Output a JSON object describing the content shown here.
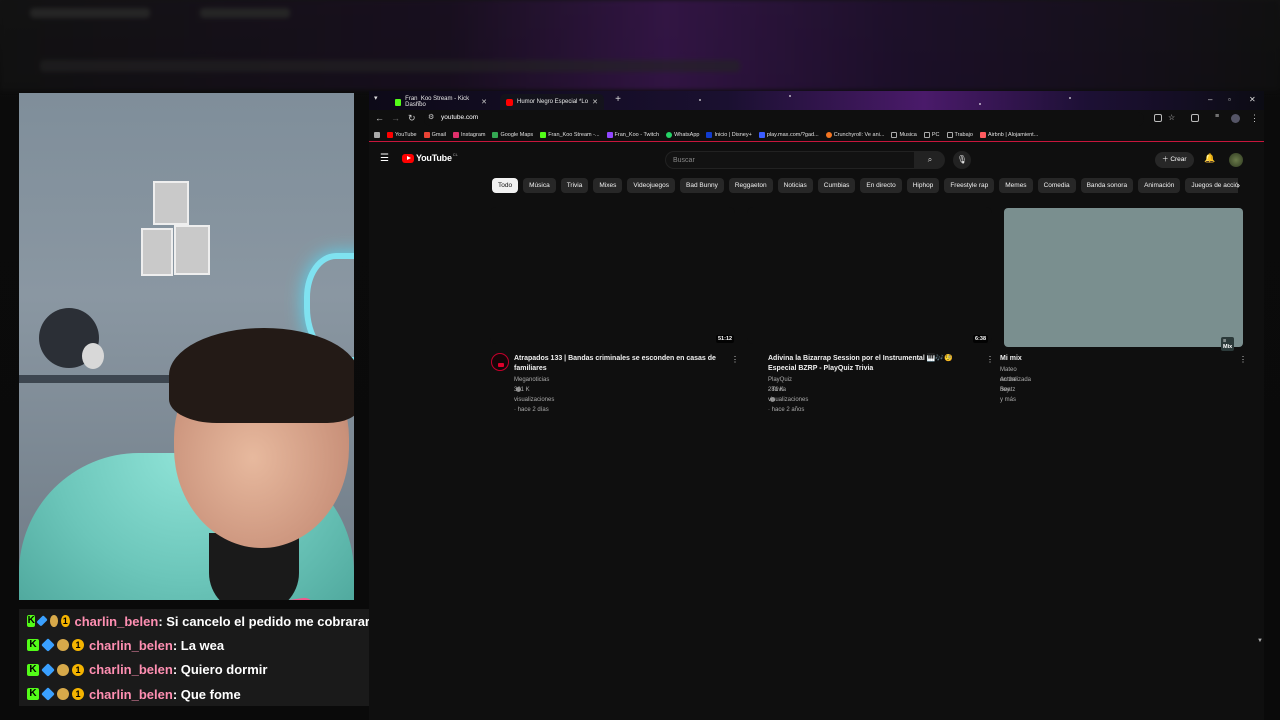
{
  "browser": {
    "tabs": [
      {
        "title": "Fran_Koo Stream - Kick Dashbo",
        "color": "#53fc18"
      },
      {
        "title": "Humor Negro Especial *Lo",
        "color": "#ff0000"
      }
    ],
    "url": "youtube.com",
    "bookmarks": [
      {
        "label": "YouTube",
        "color": "#ff0000"
      },
      {
        "label": "Gmail",
        "color": "#ea4335"
      },
      {
        "label": "Instagram",
        "color": "#e1306c"
      },
      {
        "label": "Google Maps",
        "color": "#34a853"
      },
      {
        "label": "Fran_Koo Stream -...",
        "color": "#53fc18"
      },
      {
        "label": "Fran_Koo - Twitch",
        "color": "#9146ff"
      },
      {
        "label": "WhatsApp",
        "color": "#25d366"
      },
      {
        "label": "Inicio | Disney+",
        "color": "#113ccf"
      },
      {
        "label": "play.max.com/?gad...",
        "color": "#3a5cff"
      },
      {
        "label": "Crunchyroll: Ve ani...",
        "color": "#f47521"
      },
      {
        "label": "Musica",
        "color": "#888888"
      },
      {
        "label": "PC",
        "color": "#888888"
      },
      {
        "label": "Trabajo",
        "color": "#888888"
      },
      {
        "label": "Airbnb | Alojamient...",
        "color": "#ff5a5f"
      }
    ]
  },
  "youtube": {
    "logo_text": "YouTube",
    "country": "CL",
    "search_placeholder": "Buscar",
    "create_label": "Crear",
    "chips": [
      "Todo",
      "Música",
      "Trivia",
      "Mixes",
      "Videojuegos",
      "Bad Bunny",
      "Reggaeton",
      "Noticias",
      "Cumbias",
      "En directo",
      "Hiphop",
      "Freestyle rap",
      "Memes",
      "Comedia",
      "Banda sonora",
      "Animación",
      "Juegos de acción"
    ],
    "videos": [
      {
        "duration": "51:12",
        "title": "Atrapados 133 | Bandas criminales se esconden en casas de familiares",
        "channel": "Meganoticias",
        "stats": "301 K visualizaciones · hace 2 días"
      },
      {
        "duration": "6:38",
        "title": "Adivina la Bizarrap Session por el Instrumental 🎹🎶🧐 Especial BZRP - PlayQuiz Trivia",
        "channel": "PlayQuiz - Trivia",
        "stats": "281 K visualizaciones · hace 2 años"
      },
      {
        "badge": "Mix",
        "title": "Mi mix",
        "channel": "Mateo on the Beatz y más",
        "stats": "Actualizada hoy"
      }
    ]
  },
  "chat": [
    {
      "user": "charlin_belen",
      "text": ": Si cancelo el pedido me cobrarar"
    },
    {
      "user": "charlin_belen",
      "text": ": La wea"
    },
    {
      "user": "charlin_belen",
      "text": ": Quiero dormir"
    },
    {
      "user": "charlin_belen",
      "text": ": Que fome"
    }
  ]
}
